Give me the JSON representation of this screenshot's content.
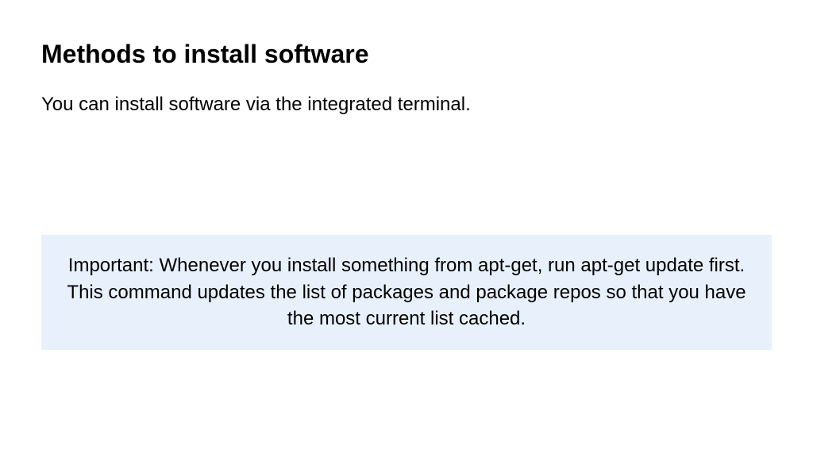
{
  "title": "Methods to install software",
  "intro": "You can install software via the integrated terminal.",
  "callout": "Important: Whenever you install something from apt-get, run apt-get update first. This command updates the list of packages and package repos so that you have the most current list cached."
}
